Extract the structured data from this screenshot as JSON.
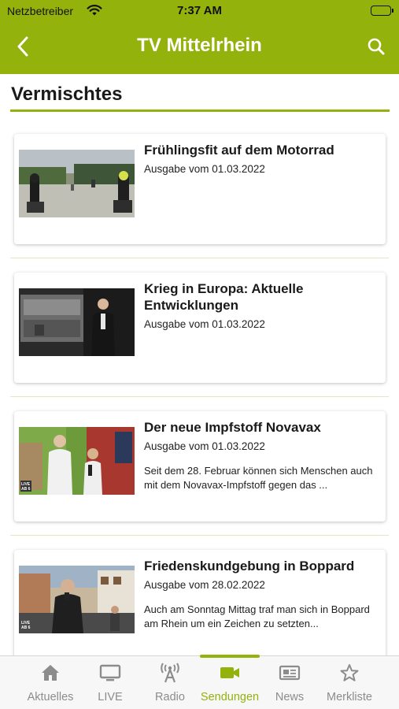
{
  "status_bar": {
    "carrier": "Netzbetreiber",
    "time": "7:37 AM"
  },
  "header": {
    "title": "TV Mittelrhein",
    "back_icon": "chevron-left-icon",
    "search_icon": "search-icon"
  },
  "section": {
    "title": "Vermischtes"
  },
  "colors": {
    "accent": "#93b20c",
    "text": "#1a1a1a"
  },
  "items": [
    {
      "title": "Frühlingsfit auf dem Motorrad",
      "date": "Ausgabe vom 01.03.2022",
      "description": ""
    },
    {
      "title": "Krieg in Europa: Aktuelle Entwicklungen",
      "date": "Ausgabe vom 01.03.2022",
      "description": ""
    },
    {
      "title": "Der neue Impfstoff Novavax",
      "date": "Ausgabe vom 01.03.2022",
      "description": "Seit dem 28. Februar können sich Menschen auch mit dem Novavax-Impfstoff gegen das ..."
    },
    {
      "title": "Friedenskundgebung in Boppard",
      "date": "Ausgabe vom 28.02.2022",
      "description": "Auch am Sonntag Mittag traf man sich in Boppard am Rhein um ein Zeichen zu setzten..."
    }
  ],
  "tabs": [
    {
      "label": "Aktuelles",
      "icon": "home-icon"
    },
    {
      "label": "LIVE",
      "icon": "tv-icon"
    },
    {
      "label": "Radio",
      "icon": "radio-antenna-icon"
    },
    {
      "label": "Sendungen",
      "icon": "video-camera-icon",
      "active": true
    },
    {
      "label": "News",
      "icon": "newspaper-icon"
    },
    {
      "label": "Merkliste",
      "icon": "star-icon"
    }
  ],
  "thumb_badges": {
    "item3": "LIVE AB 6",
    "item4": "LIVE AB 6"
  }
}
